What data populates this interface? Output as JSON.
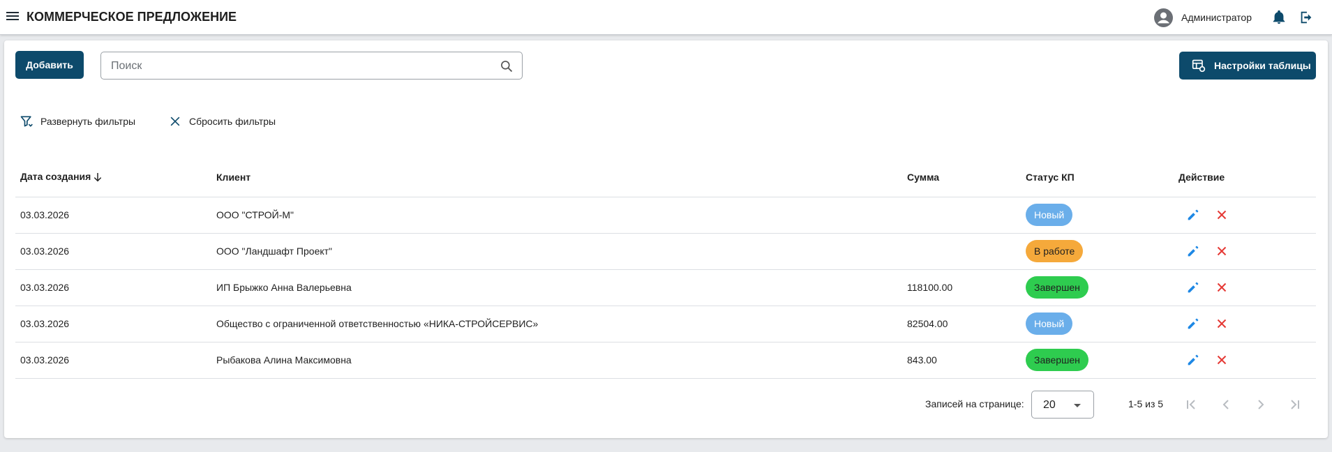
{
  "header": {
    "title": "КОММЕРЧЕСКОЕ ПРЕДЛОЖЕНИЕ",
    "user_name": "Администратор",
    "icons": [
      "menu-icon",
      "account-icon",
      "bell-icon",
      "logout-icon"
    ]
  },
  "toolbar": {
    "add_label": "Добавить",
    "search_placeholder": "Поиск",
    "settings_label": "Настройки таблицы"
  },
  "filters": {
    "expand_label": "Развернуть фильтры",
    "reset_label": "Сбросить фильтры"
  },
  "table": {
    "columns": [
      "Дата создания",
      "Клиент",
      "Сумма",
      "Статус КП",
      "Действие"
    ],
    "rows": [
      {
        "date": "03.03.2026",
        "client": "ООО \"СТРОЙ-М\"",
        "sum": "",
        "status": "Новый",
        "status_color": "#6aaeea"
      },
      {
        "date": "03.03.2026",
        "client": "ООО \"Ландшафт Проект\"",
        "sum": "",
        "status": "В работе",
        "status_color": "#f5a93b"
      },
      {
        "date": "03.03.2026",
        "client": "ИП Брыжко Анна Валерьевна",
        "sum": "118100.00",
        "status": "Завершен",
        "status_color": "#2ecc4f"
      },
      {
        "date": "03.03.2026",
        "client": "Общество с ограниченной ответственностью «НИКА-СТРОЙСЕРВИС»",
        "sum": "82504.00",
        "status": "Новый",
        "status_color": "#6aaeea"
      },
      {
        "date": "03.03.2026",
        "client": "Рыбакова Алина Максимовна",
        "sum": "843.00",
        "status": "Завершен",
        "status_color": "#2ecc4f"
      }
    ]
  },
  "pagination": {
    "per_page_label": "Записей на странице:",
    "per_page_value": "20",
    "range_label": "1-5 из 5"
  },
  "colors": {
    "primary": "#0d4a6b",
    "edit": "#1e88e5",
    "delete": "#e53935"
  }
}
